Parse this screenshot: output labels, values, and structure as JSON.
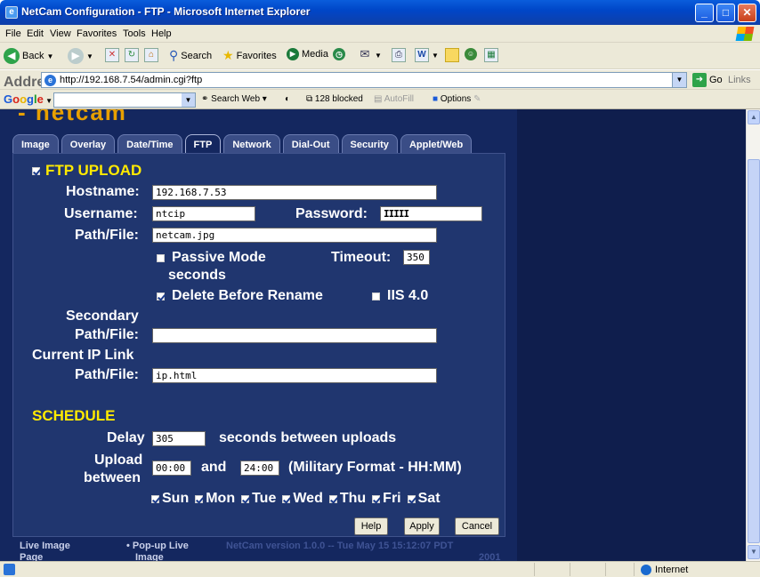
{
  "window": {
    "title": "NetCam Configuration - FTP - Microsoft Internet Explorer"
  },
  "menu": [
    "File",
    "Edit",
    "View",
    "Favorites",
    "Tools",
    "Help"
  ],
  "toolbar": {
    "back": "Back",
    "search": "Search",
    "favorites": "Favorites",
    "media": "Media"
  },
  "address": {
    "label": "Address",
    "url": "http://192.168.7.54/admin.cgi?ftp",
    "go": "Go",
    "links": "Links"
  },
  "googlebar": {
    "logo": "Google",
    "search_web": "Search Web",
    "blocked": "128 blocked",
    "autofill": "AutoFill",
    "options": "Options"
  },
  "tabs": [
    {
      "label": "Image",
      "active": false
    },
    {
      "label": "Overlay",
      "active": false
    },
    {
      "label": "Date/Time",
      "active": false
    },
    {
      "label": "FTP",
      "active": true
    },
    {
      "label": "Network",
      "active": false
    },
    {
      "label": "Dial-Out",
      "active": false
    },
    {
      "label": "Security",
      "active": false
    },
    {
      "label": "Applet/Web",
      "active": false
    }
  ],
  "ftp": {
    "section_title": "FTP UPLOAD",
    "enabled": true,
    "hostname_label": "Hostname:",
    "hostname": "192.168.7.53",
    "username_label": "Username:",
    "username": "ntcip",
    "password_label": "Password:",
    "password_mask": "IIIII",
    "path_label": "Path/File:",
    "path": "netcam.jpg",
    "passive_label": "Passive Mode",
    "passive_checked": false,
    "timeout_label": "Timeout:",
    "timeout": "350",
    "seconds_label": "seconds",
    "delete_label": "Delete Before Rename",
    "delete_checked": true,
    "iis_label": "IIS 4.0",
    "iis_checked": false,
    "secondary_label_1": "Secondary",
    "secondary_label_2": "Path/File:",
    "secondary_path": "",
    "currentip_label_1": "Current IP Link",
    "currentip_label_2": "Path/File:",
    "currentip_path": "ip.html"
  },
  "schedule": {
    "section_title": "SCHEDULE",
    "delay_label": "Delay",
    "delay": "305",
    "delay_suffix": "seconds between uploads",
    "upload_label_1": "Upload",
    "upload_label_2": "between",
    "start": "00:00",
    "and_label": "and",
    "end": "24:00",
    "format_label": "(Military Format - HH:MM)",
    "days": [
      {
        "label": "Sun",
        "checked": true
      },
      {
        "label": "Mon",
        "checked": true
      },
      {
        "label": "Tue",
        "checked": true
      },
      {
        "label": "Wed",
        "checked": true
      },
      {
        "label": "Thu",
        "checked": true
      },
      {
        "label": "Fri",
        "checked": true
      },
      {
        "label": "Sat",
        "checked": true
      }
    ]
  },
  "buttons": {
    "help": "Help",
    "apply": "Apply",
    "cancel": "Cancel"
  },
  "footer": {
    "live_image": "Live Image",
    "live_image_2": "Page",
    "popup": "Pop-up Live",
    "popup_2": "Image",
    "version": "NetCam version 1.0.0 -- Tue May 15 15:12:07 PDT",
    "year": "2001"
  },
  "status": {
    "zone": "Internet"
  },
  "colors": {
    "page_bg": "#14275f",
    "panel_bg": "#20366f",
    "section_title": "#ffea00",
    "xp_blue": "#0046c8"
  }
}
